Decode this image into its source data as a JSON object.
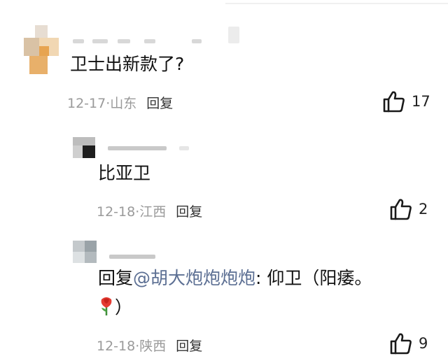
{
  "comments": [
    {
      "text": "卫士出新款了?",
      "date": "12-17",
      "sep": "·",
      "location": "山东",
      "reply_label": "回复",
      "likes": "17"
    },
    {
      "text": "比亚卫",
      "date": "12-18",
      "sep": "·",
      "location": "江西",
      "reply_label": "回复",
      "likes": "2"
    },
    {
      "reply_prefix": "回复",
      "mention": "@胡大炮炮炮炮",
      "text_after": ": 仰卫（阳痿。",
      "line2_after": "）",
      "emoji": "rose-icon",
      "date": "12-18",
      "sep": "·",
      "location": "陕西",
      "reply_label": "回复",
      "likes": "9"
    }
  ],
  "colors": {
    "mention": "#5c6f93",
    "meta": "#9a9a9a",
    "text": "#111111"
  }
}
